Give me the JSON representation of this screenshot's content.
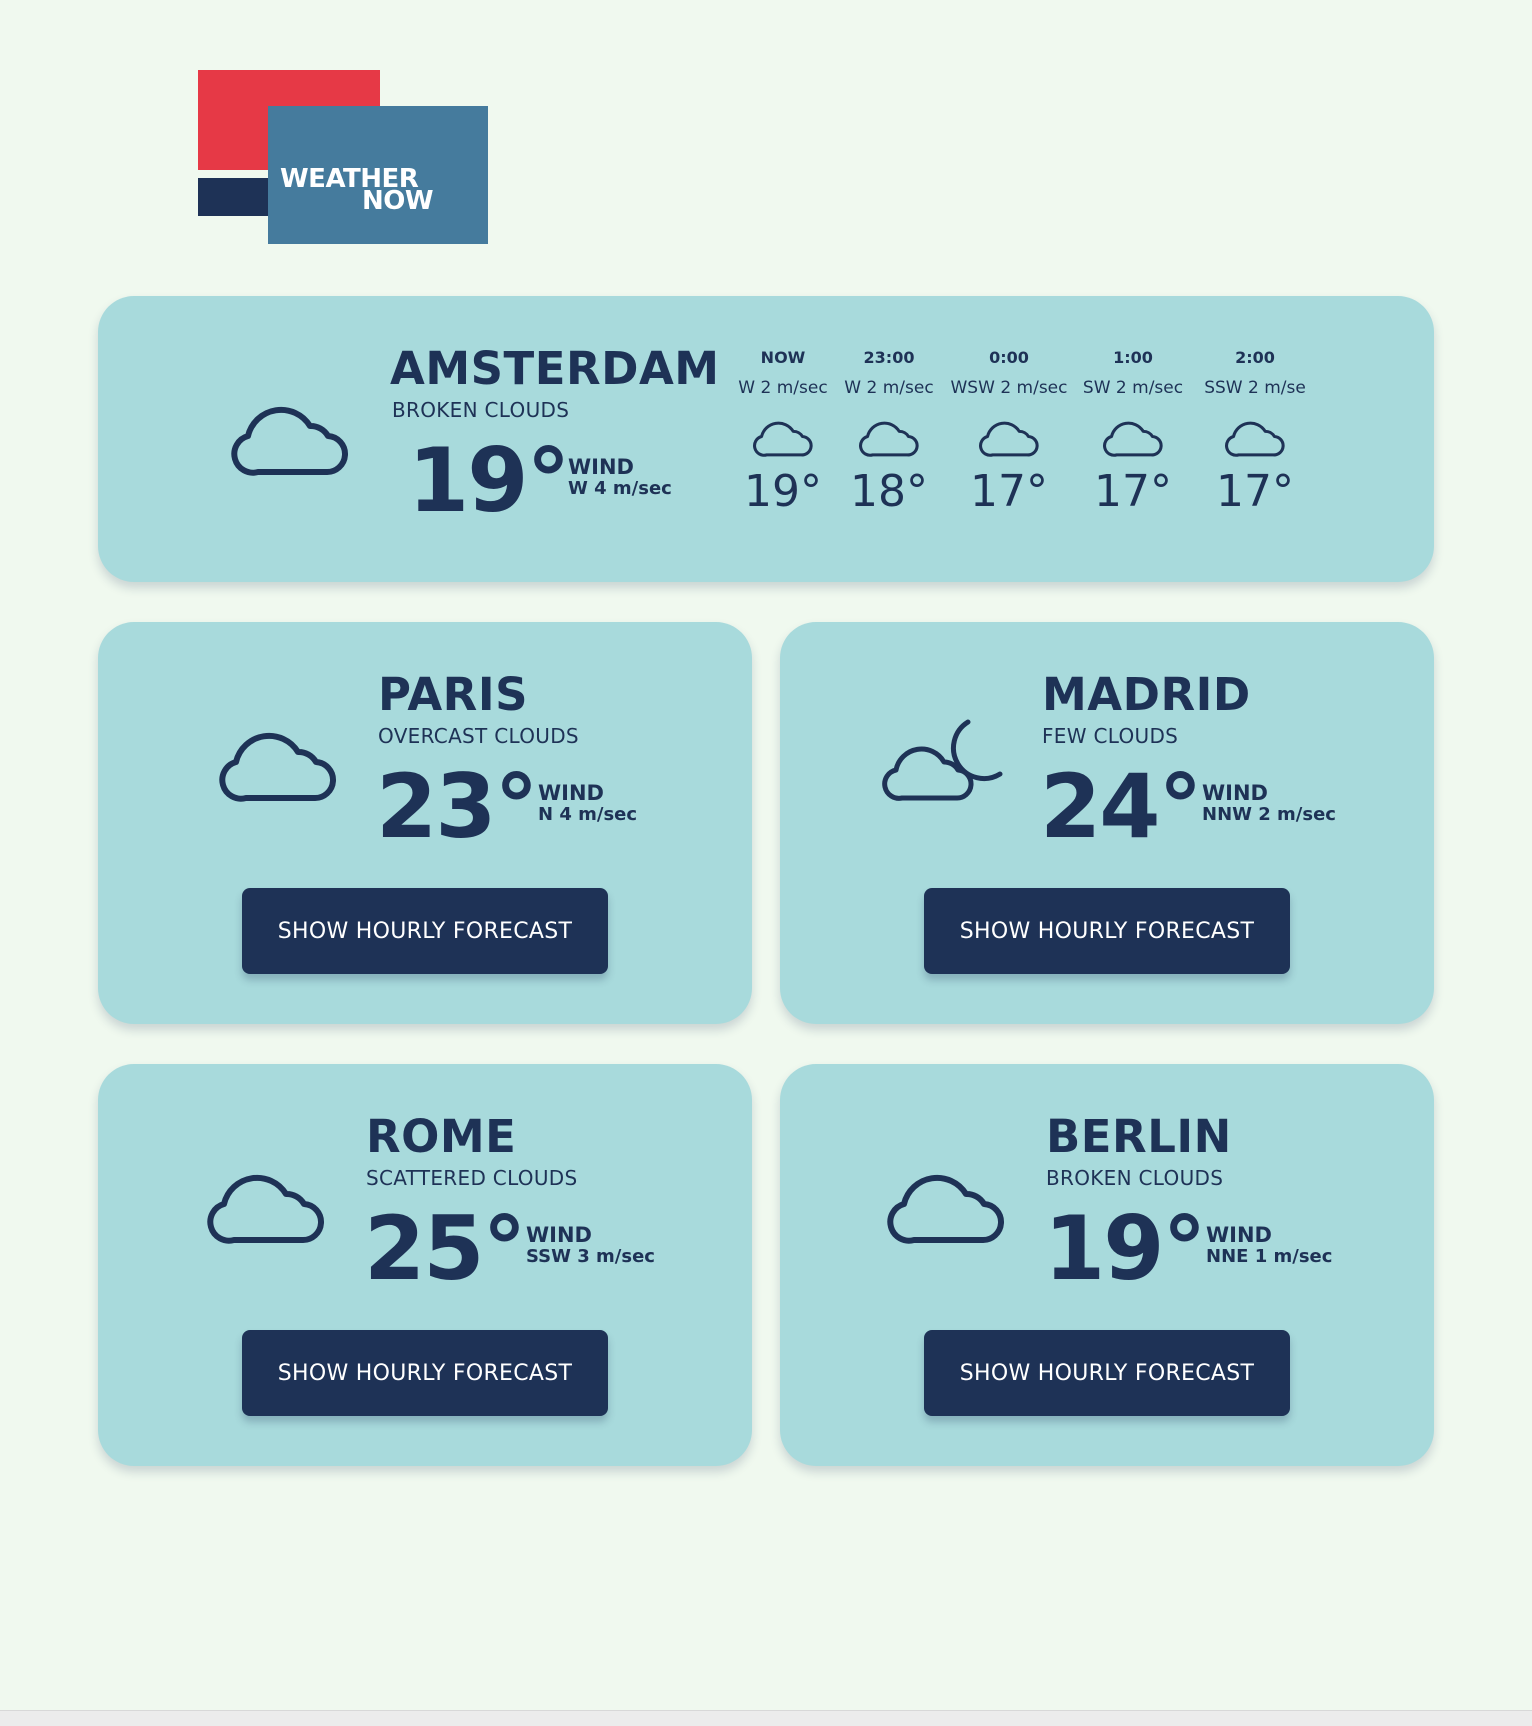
{
  "logo": {
    "line1": "WEATHER",
    "line2": "NOW"
  },
  "colors": {
    "background": "#f0f9ef",
    "card": "#a8dadc",
    "navy": "#1e3256",
    "red": "#e63946",
    "blue": "#457b9d"
  },
  "main_city": {
    "name": "AMSTERDAM",
    "description": "BROKEN CLOUDS",
    "temperature": "19°",
    "wind_label": "WIND",
    "wind_value": "W 4 m/sec",
    "icon": "cloud-icon",
    "hourly": [
      {
        "time": "NOW",
        "wind": "W 2 m/sec",
        "temp": "19°",
        "icon": "cloud-icon"
      },
      {
        "time": "23:00",
        "wind": "W 2 m/sec",
        "temp": "18°",
        "icon": "cloud-icon"
      },
      {
        "time": "0:00",
        "wind": "WSW 2 m/sec",
        "temp": "17°",
        "icon": "cloud-icon"
      },
      {
        "time": "1:00",
        "wind": "SW 2 m/sec",
        "temp": "17°",
        "icon": "cloud-icon"
      },
      {
        "time": "2:00",
        "wind": "SSW 2 m/se",
        "temp": "17°",
        "icon": "cloud-icon"
      }
    ]
  },
  "cities": [
    {
      "name": "PARIS",
      "description": "OVERCAST CLOUDS",
      "temperature": "23°",
      "wind_label": "WIND",
      "wind_value": "N 4 m/sec",
      "icon": "cloud-icon",
      "button": "SHOW HOURLY FORECAST"
    },
    {
      "name": "MADRID",
      "description": "FEW CLOUDS",
      "temperature": "24°",
      "wind_label": "WIND",
      "wind_value": "NNW 2 m/sec",
      "icon": "cloud-moon-icon",
      "button": "SHOW HOURLY FORECAST"
    },
    {
      "name": "ROME",
      "description": "SCATTERED CLOUDS",
      "temperature": "25°",
      "wind_label": "WIND",
      "wind_value": "SSW 3 m/sec",
      "icon": "cloud-icon",
      "button": "SHOW HOURLY FORECAST"
    },
    {
      "name": "BERLIN",
      "description": "BROKEN CLOUDS",
      "temperature": "19°",
      "wind_label": "WIND",
      "wind_value": "NNE 1 m/sec",
      "icon": "cloud-icon",
      "button": "SHOW HOURLY FORECAST"
    }
  ]
}
